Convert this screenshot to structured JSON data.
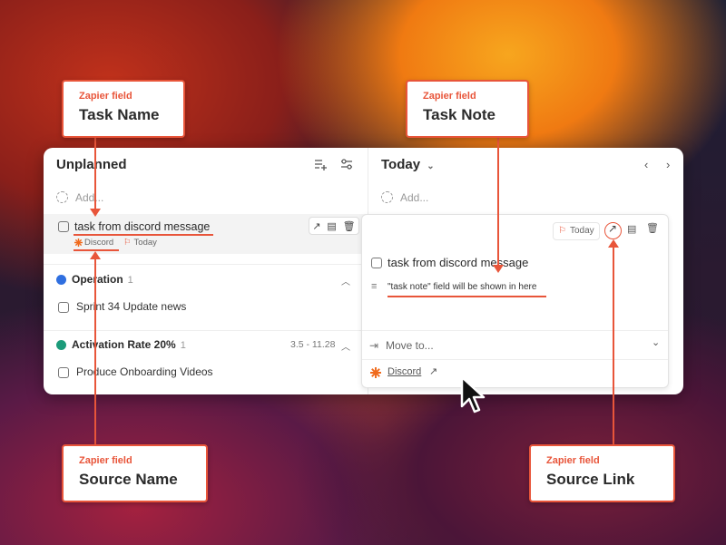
{
  "left_panel": {
    "title": "Unplanned",
    "add_label": "Add...",
    "selected_task": {
      "title": "task from discord message",
      "source_tag": "Discord",
      "date_tag": "Today"
    },
    "groups": [
      {
        "name": "Operation",
        "count": "1",
        "color": "#2f6fe0",
        "items": [
          "Sprint 34 Update news"
        ]
      },
      {
        "name": "Activation Rate 20%",
        "count": "1",
        "date_range": "3.5 - 11.28",
        "color": "#1c9b7a",
        "items": [
          "Produce Onboarding Videos"
        ]
      }
    ]
  },
  "right_panel": {
    "title": "Today",
    "add_label": "Add...",
    "detail": {
      "date_chip": "Today",
      "task_title": "task from discord message",
      "note": "\"task note\" field will be shown in here",
      "move_to_label": "Move to...",
      "source_link_label": "Discord"
    }
  },
  "callouts": {
    "task_name": {
      "kicker": "Zapier field",
      "label": "Task Name"
    },
    "task_note": {
      "kicker": "Zapier field",
      "label": "Task Note"
    },
    "source_name": {
      "kicker": "Zapier field",
      "label": "Source Name"
    },
    "source_link": {
      "kicker": "Zapier field",
      "label": "Source Link"
    }
  },
  "colors": {
    "accent": "#e8553a",
    "discord_orange": "#f06a1c"
  }
}
